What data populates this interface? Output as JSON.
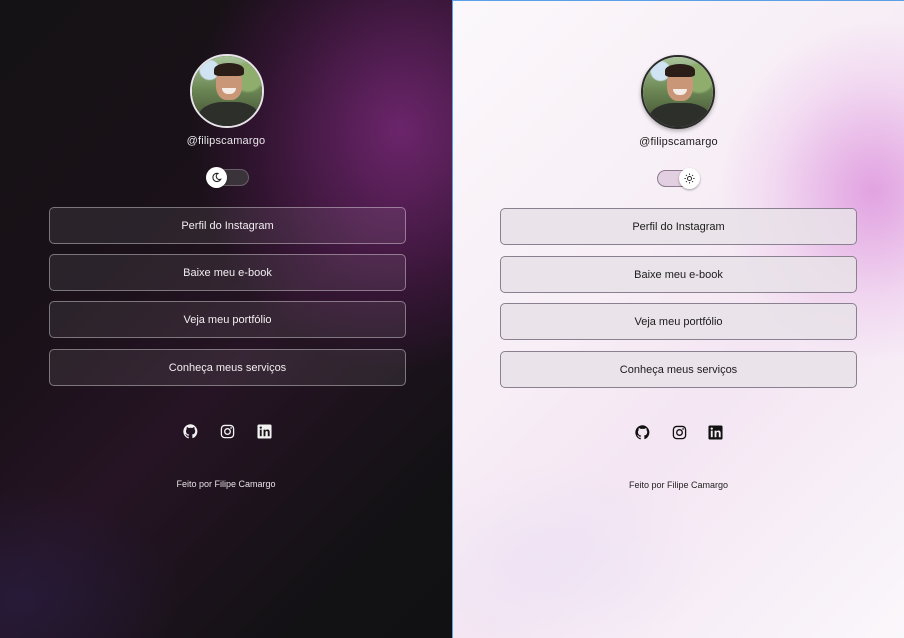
{
  "profile": {
    "handle": "@filipscamargo",
    "avatar_icon": "profile-photo"
  },
  "theme_toggle": {
    "dark_mode_icon": "moon-icon",
    "light_mode_icon": "sun-icon"
  },
  "links": [
    {
      "label": "Perfil do Instagram"
    },
    {
      "label": "Baixe meu e-book"
    },
    {
      "label": "Veja meu portfólio"
    },
    {
      "label": "Conheça meus serviços"
    }
  ],
  "social": [
    "github-icon",
    "instagram-icon",
    "linkedin-icon"
  ],
  "footer": {
    "text": "Feito por Filipe Camargo"
  },
  "colors": {
    "dark_accent": "#6e2a6a",
    "light_accent": "#de96de",
    "selection_outline": "#5aa0e6"
  }
}
